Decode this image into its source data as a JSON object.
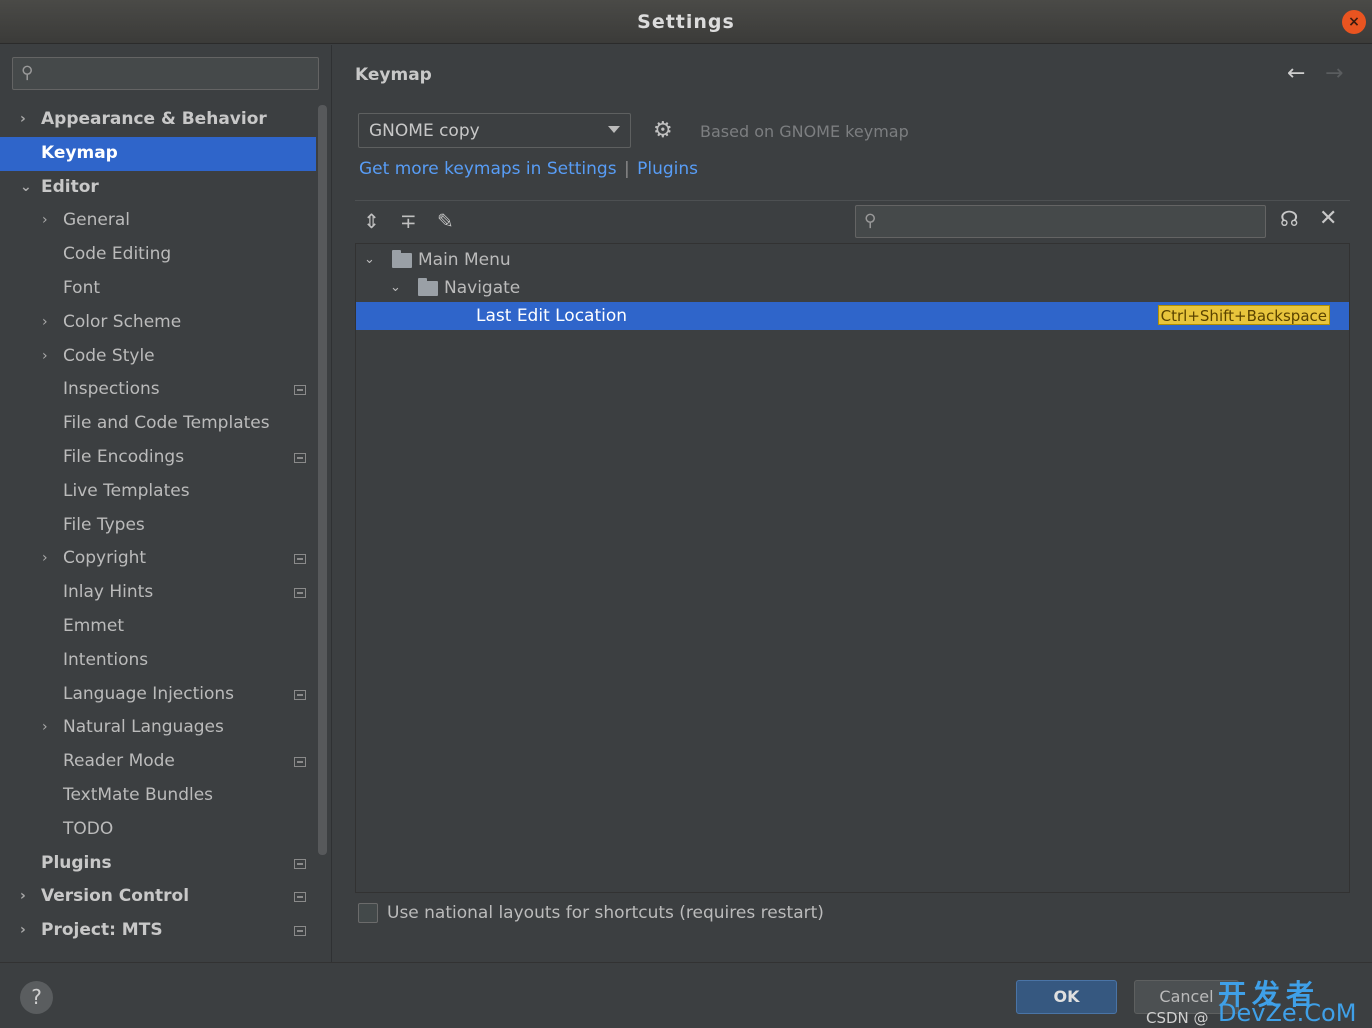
{
  "window": {
    "title": "Settings",
    "close_glyph": "×"
  },
  "sidebar": {
    "items": [
      {
        "label": "Appearance & Behavior",
        "indent": 0,
        "arrow": "›",
        "bold": true,
        "selected": false,
        "badge": false
      },
      {
        "label": "Keymap",
        "indent": 0,
        "arrow": "",
        "bold": true,
        "selected": true,
        "badge": false
      },
      {
        "label": "Editor",
        "indent": 0,
        "arrow": "⌄",
        "bold": true,
        "selected": false,
        "badge": false
      },
      {
        "label": "General",
        "indent": 1,
        "arrow": "›",
        "bold": false,
        "selected": false,
        "badge": false
      },
      {
        "label": "Code Editing",
        "indent": 1,
        "arrow": "",
        "bold": false,
        "selected": false,
        "badge": false
      },
      {
        "label": "Font",
        "indent": 1,
        "arrow": "",
        "bold": false,
        "selected": false,
        "badge": false
      },
      {
        "label": "Color Scheme",
        "indent": 1,
        "arrow": "›",
        "bold": false,
        "selected": false,
        "badge": false
      },
      {
        "label": "Code Style",
        "indent": 1,
        "arrow": "›",
        "bold": false,
        "selected": false,
        "badge": false
      },
      {
        "label": "Inspections",
        "indent": 1,
        "arrow": "",
        "bold": false,
        "selected": false,
        "badge": true
      },
      {
        "label": "File and Code Templates",
        "indent": 1,
        "arrow": "",
        "bold": false,
        "selected": false,
        "badge": false
      },
      {
        "label": "File Encodings",
        "indent": 1,
        "arrow": "",
        "bold": false,
        "selected": false,
        "badge": true
      },
      {
        "label": "Live Templates",
        "indent": 1,
        "arrow": "",
        "bold": false,
        "selected": false,
        "badge": false
      },
      {
        "label": "File Types",
        "indent": 1,
        "arrow": "",
        "bold": false,
        "selected": false,
        "badge": false
      },
      {
        "label": "Copyright",
        "indent": 1,
        "arrow": "›",
        "bold": false,
        "selected": false,
        "badge": true
      },
      {
        "label": "Inlay Hints",
        "indent": 1,
        "arrow": "",
        "bold": false,
        "selected": false,
        "badge": true
      },
      {
        "label": "Emmet",
        "indent": 1,
        "arrow": "",
        "bold": false,
        "selected": false,
        "badge": false
      },
      {
        "label": "Intentions",
        "indent": 1,
        "arrow": "",
        "bold": false,
        "selected": false,
        "badge": false
      },
      {
        "label": "Language Injections",
        "indent": 1,
        "arrow": "",
        "bold": false,
        "selected": false,
        "badge": true
      },
      {
        "label": "Natural Languages",
        "indent": 1,
        "arrow": "›",
        "bold": false,
        "selected": false,
        "badge": false
      },
      {
        "label": "Reader Mode",
        "indent": 1,
        "arrow": "",
        "bold": false,
        "selected": false,
        "badge": true
      },
      {
        "label": "TextMate Bundles",
        "indent": 1,
        "arrow": "",
        "bold": false,
        "selected": false,
        "badge": false
      },
      {
        "label": "TODO",
        "indent": 1,
        "arrow": "",
        "bold": false,
        "selected": false,
        "badge": false
      },
      {
        "label": "Plugins",
        "indent": 0,
        "arrow": "",
        "bold": true,
        "selected": false,
        "badge": true
      },
      {
        "label": "Version Control",
        "indent": 0,
        "arrow": "›",
        "bold": true,
        "selected": false,
        "badge": true
      },
      {
        "label": "Project: MTS",
        "indent": 0,
        "arrow": "›",
        "bold": true,
        "selected": false,
        "badge": true
      }
    ]
  },
  "main": {
    "title": "Keymap",
    "back_glyph": "←",
    "forward_glyph": "→",
    "keymap_select": {
      "value": "GNOME copy"
    },
    "based_on": "Based on GNOME keymap",
    "link_settings": "Get more keymaps in Settings",
    "link_sep": "|",
    "link_plugins": "Plugins",
    "toolbar": {
      "expand_glyph": "⇕",
      "collapse_glyph": "∓",
      "edit_glyph": "✎",
      "find_glyph": "☊",
      "clear_glyph": "✕"
    },
    "tree": [
      {
        "label": "Main Menu",
        "level": 0,
        "arrow": "⌄",
        "folder": true,
        "selected": false,
        "shortcut": ""
      },
      {
        "label": "Navigate",
        "level": 1,
        "arrow": "⌄",
        "folder": true,
        "selected": false,
        "shortcut": ""
      },
      {
        "label": "Last Edit Location",
        "level": 2,
        "arrow": "",
        "folder": false,
        "selected": true,
        "shortcut": "Ctrl+Shift+Backspace"
      }
    ],
    "national_layouts_label": "Use national layouts for shortcuts (requires restart)"
  },
  "footer": {
    "help": "?",
    "ok": "OK",
    "cancel": "Cancel"
  },
  "watermark": {
    "cn": "开发者",
    "en": "DevZe.CoM",
    "csdn": "CSDN @"
  },
  "colors": {
    "background": "#3c3f41",
    "selection": "#2f65ca",
    "link": "#589df6",
    "shortcut_highlight": "#e8c53c",
    "close_button": "#e95420"
  },
  "icons": {
    "search": "search-icon",
    "gear": "gear-icon",
    "folder": "folder-icon",
    "expand": "expand-all-icon",
    "collapse": "collapse-all-icon",
    "edit": "edit-icon",
    "find_shortcut": "find-by-shortcut-icon",
    "clear": "clear-filter-icon"
  }
}
